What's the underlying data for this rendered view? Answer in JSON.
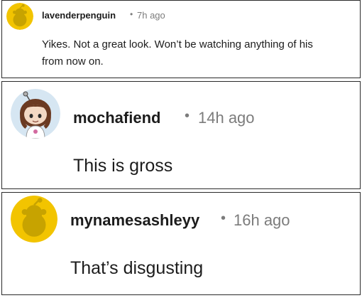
{
  "comments": [
    {
      "username": "lavenderpenguin",
      "separator": "•",
      "time": "7h ago",
      "text_lines": [
        "Yikes. Not a great look. Won’t be watching anything of his",
        "from now on."
      ],
      "avatar": {
        "icon": "snoo-default-avatar-icon",
        "bg_color": "#f2c400",
        "fg_color": "#c7a300"
      }
    },
    {
      "username": "mochafiend",
      "separator": "•",
      "time": "14h ago",
      "text": "This is gross",
      "avatar": {
        "icon": "snoo-custom-avatar-icon",
        "bg_color": "#d6e6f2",
        "hair_color": "#6b3a22"
      }
    },
    {
      "username": "mynamesashleyy",
      "separator": "•",
      "time": "16h ago",
      "text": "That’s disgusting",
      "avatar": {
        "icon": "snoo-default-avatar-icon",
        "bg_color": "#f2c400",
        "fg_color": "#c7a300"
      }
    }
  ]
}
